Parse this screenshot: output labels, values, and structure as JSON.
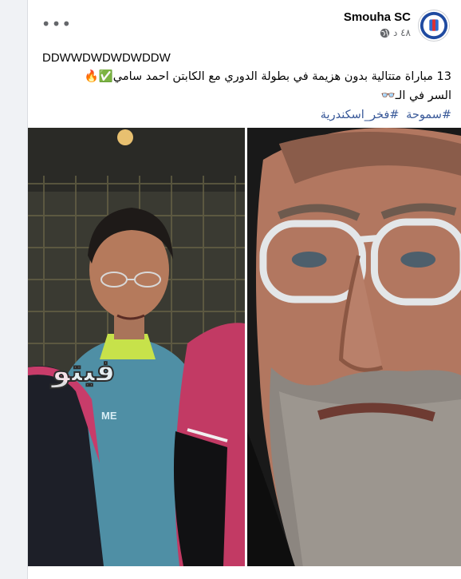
{
  "post": {
    "page_name": "Smouha SC",
    "timestamp": "٤٨ د",
    "audience_icon": "globe-icon",
    "more_icon": "ellipsis-icon",
    "text_line1": "DDWWDWDWDWDDW",
    "text_line2": "13 مباراة متتالية بدون هزيمة في بطولة الدوري مع الكابتن احمد سامي✅🔥",
    "text_line3": "السر في الـ👓",
    "hashtags": [
      "#سموحة",
      "#فخر_اسكندرية"
    ]
  },
  "images": {
    "watermark_text": "فيتو"
  },
  "colors": {
    "link": "#385898",
    "secondary_text": "#65676b",
    "primary_text": "#050505"
  }
}
